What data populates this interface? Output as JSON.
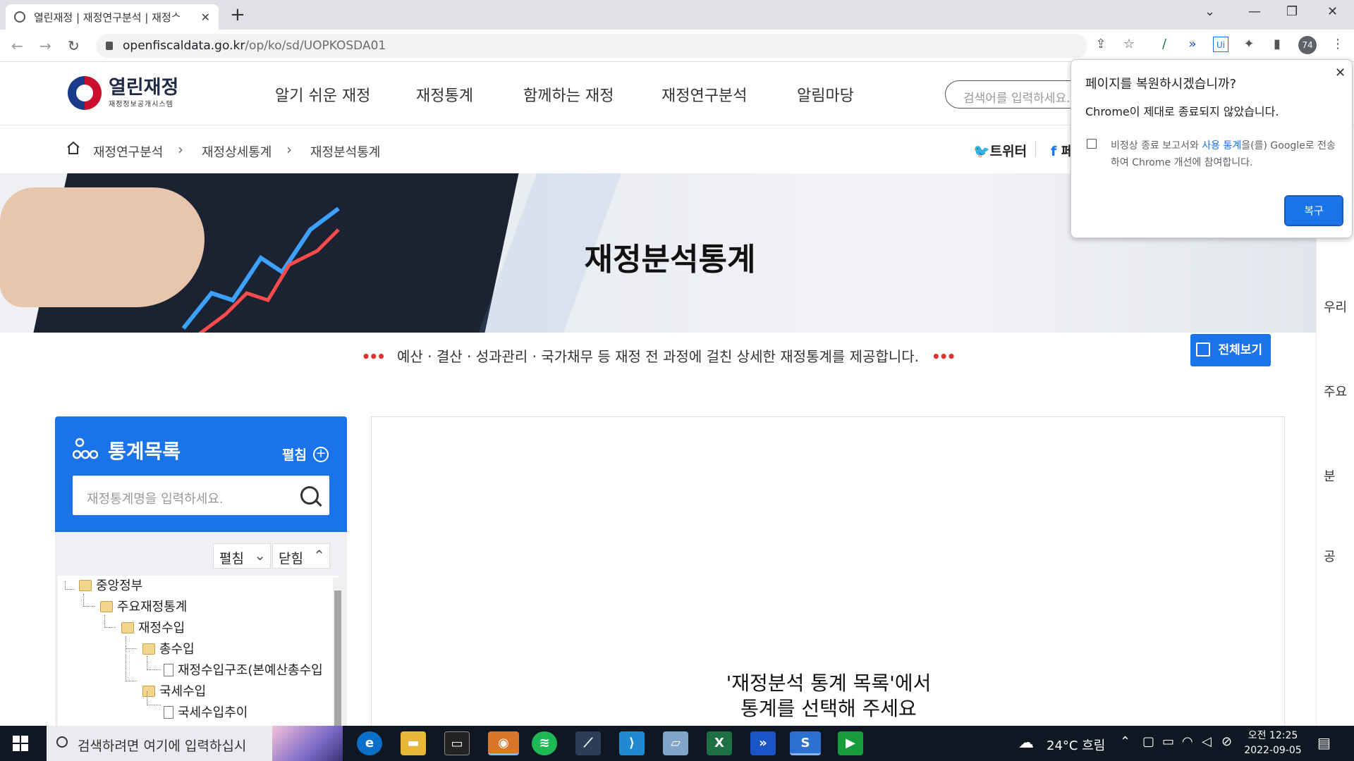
{
  "browser": {
    "tab_title": "열린재정 | 재정연구분석 | 재정ᄉ",
    "url_domain": "openfiscaldata.go.kr",
    "url_path": "/op/ko/sd/UOPKOSDA01",
    "profile_label": "74"
  },
  "header": {
    "logo_name": "열린재정",
    "logo_sub": "재정정보공개시스템",
    "nav": [
      "알기 쉬운 재정",
      "재정통계",
      "함께하는 재정",
      "재정연구분석",
      "알림마당"
    ],
    "search_placeholder": "검색어를 입력하세요."
  },
  "breadcrumb": {
    "items": [
      "재정연구분석",
      "재정상세통계",
      "재정분석통계"
    ],
    "share_twitter": "트위터",
    "share_facebook": "페"
  },
  "banner": {
    "title": "재정분석통계",
    "intro": "예산 · 결산 · 성과관리 · 국가채무 등 재정 전 과정에 걸친 상세한 재정통계를 제공합니다.",
    "dots": "•••",
    "fullview_label": "전체보기"
  },
  "stat_panel": {
    "title": "통계목록",
    "expand_label": "펼침",
    "search_placeholder": "재정통계명을 입력하세요.",
    "expand_all": "펼침",
    "collapse_all": "닫힘",
    "tree": [
      "중앙정부",
      "주요재정통계",
      "재정수입",
      "총수입",
      "재정수입구조(본예산총수입",
      "국세수입",
      "국세수입추이"
    ]
  },
  "content": {
    "empty_line1": "'재정분석 통계 목록'에서",
    "empty_line2": "통계를 선택해 주세요"
  },
  "right_side": [
    "우리",
    "주요",
    "분",
    "공"
  ],
  "restore_popup": {
    "title": "페이지를 복원하시겠습니까?",
    "message": "Chrome이 제대로 종료되지 않았습니다.",
    "checkbox_text_pre": "비정상 종료 보고서와 ",
    "checkbox_link": "사용 통계",
    "checkbox_text_post": "을(를) Google로 전송하여 Chrome 개선에 참여합니다.",
    "button": "복구"
  },
  "taskbar": {
    "search_placeholder": "검색하려면 여기에 입력하십시",
    "weather": "24°C 흐림",
    "time": "오전 12:25",
    "date": "2022-09-05"
  },
  "colors": {
    "accent": "#1a73e8",
    "taskbar": "#0f1722",
    "dots": "#dd3333"
  }
}
